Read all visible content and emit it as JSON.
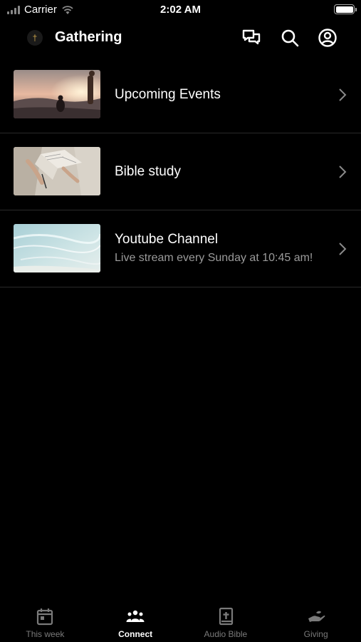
{
  "status_bar": {
    "carrier": "Carrier",
    "time": "2:02 AM"
  },
  "header": {
    "title": "Gathering"
  },
  "list": [
    {
      "title": "Upcoming Events",
      "subtitle": ""
    },
    {
      "title": "Bible study",
      "subtitle": ""
    },
    {
      "title": "Youtube Channel",
      "subtitle": "Live stream every Sunday at 10:45 am!"
    }
  ],
  "tabs": [
    {
      "label": "This week",
      "icon": "calendar-icon"
    },
    {
      "label": "Connect",
      "icon": "people-group-icon"
    },
    {
      "label": "Audio Bible",
      "icon": "bible-icon"
    },
    {
      "label": "Giving",
      "icon": "giving-hand-icon"
    }
  ],
  "active_tab": "Connect",
  "colors": {
    "background": "#000000",
    "text": "#ffffff",
    "subtext": "#9a9a9a",
    "inactive_tab": "#7a7a7a",
    "divider": "#2a2a2a"
  }
}
